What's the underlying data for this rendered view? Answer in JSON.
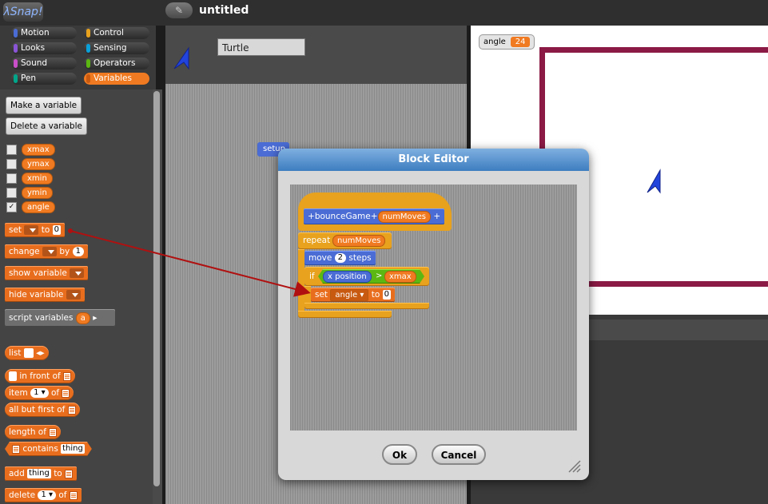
{
  "app": {
    "logo": "λSnap!",
    "project_title": "untitled",
    "edit_icon": "pencil-icon"
  },
  "categories": [
    {
      "label": "Motion",
      "color": "#4a6cd4"
    },
    {
      "label": "Control",
      "color": "#e8a21e"
    },
    {
      "label": "Looks",
      "color": "#8a55d7"
    },
    {
      "label": "Sensing",
      "color": "#0aa0d8"
    },
    {
      "label": "Sound",
      "color": "#c94fc9"
    },
    {
      "label": "Operators",
      "color": "#5cb712"
    },
    {
      "label": "Pen",
      "color": "#00a68a"
    },
    {
      "label": "Variables",
      "color": "#f07a21"
    }
  ],
  "palette": {
    "make_variable": "Make a variable",
    "delete_variable": "Delete a variable",
    "variables": [
      {
        "name": "xmax",
        "checked": false
      },
      {
        "name": "ymax",
        "checked": false
      },
      {
        "name": "xmin",
        "checked": false
      },
      {
        "name": "ymin",
        "checked": false
      },
      {
        "name": "angle",
        "checked": true
      }
    ],
    "set_block": {
      "label": "set",
      "to": "to",
      "value": "0"
    },
    "change_block": {
      "label": "change",
      "by": "by",
      "value": "1"
    },
    "show_var": "show variable",
    "hide_var": "hide variable",
    "script_vars": {
      "label": "script variables",
      "var": "a"
    },
    "list_block": "list",
    "in_front_of": "in front of",
    "item_block": {
      "label": "item",
      "value": "1",
      "of": "of"
    },
    "all_but_first": "all but first of",
    "length_of": "length of",
    "contains": {
      "label": "contains",
      "value": "thing"
    },
    "add_block": {
      "label": "add",
      "value": "thing",
      "to": "to"
    },
    "delete_block": {
      "label": "delete",
      "value": "1",
      "of": "of"
    }
  },
  "sprite": {
    "name": "Turtle",
    "script_block": "setup"
  },
  "stage": {
    "watcher_label": "angle",
    "watcher_value": "24"
  },
  "dialog": {
    "title": "Block Editor",
    "hat": {
      "plus1": "+",
      "name": "bounceGame",
      "plus2": "+",
      "param": "numMoves",
      "plus3": "+"
    },
    "repeat": {
      "label": "repeat",
      "arg": "numMoves"
    },
    "move": {
      "label": "move",
      "value": "2",
      "unit": "steps"
    },
    "if": {
      "label": "if",
      "left": "x position",
      "op": ">",
      "right": "xmax"
    },
    "set": {
      "label": "set",
      "var": "angle",
      "to": "to",
      "value": "0"
    },
    "ok": "Ok",
    "cancel": "Cancel"
  },
  "colors": {
    "accent": "#f07a21",
    "stage_rect": "#8b1a45",
    "dialog_title": "#3d7dc0",
    "arrow": "#b01010"
  }
}
